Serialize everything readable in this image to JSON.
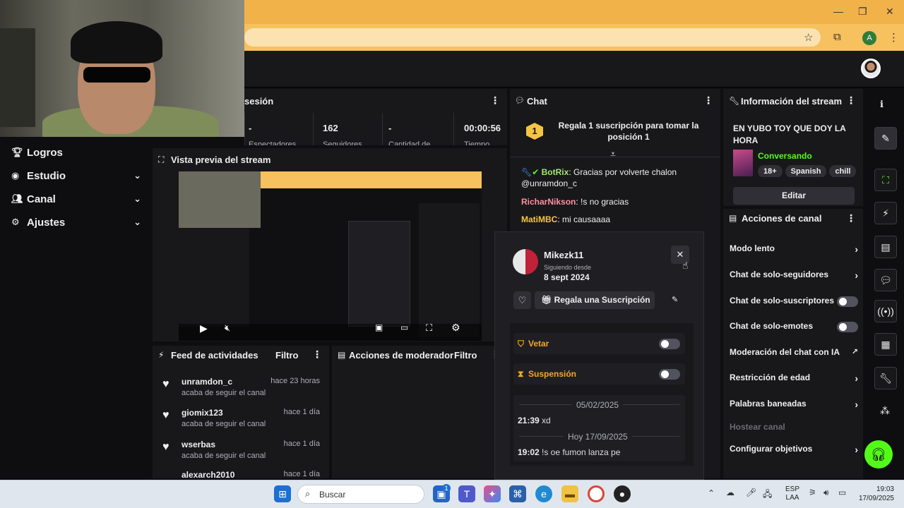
{
  "browser": {
    "window_controls": {
      "minimize": "—",
      "maximize": "❐",
      "close": "✕"
    },
    "profile_initial": "A"
  },
  "nav": {
    "items": [
      {
        "label": "Logros",
        "icon": "trophy-icon",
        "has_chevron": false
      },
      {
        "label": "Estudio",
        "icon": "studio-icon",
        "has_chevron": true
      },
      {
        "label": "Canal",
        "icon": "users-icon",
        "has_chevron": true
      },
      {
        "label": "Ajustes",
        "icon": "gear-icon",
        "has_chevron": true
      }
    ]
  },
  "session": {
    "title": "sesión",
    "stats": [
      {
        "value": "-",
        "label": "Espectadores"
      },
      {
        "value": "162",
        "label": "Seguidores"
      },
      {
        "value": "-",
        "label": "Cantidad de"
      },
      {
        "value": "00:00:56",
        "label": "Tiempo"
      }
    ]
  },
  "preview": {
    "title": "Vista previa del stream"
  },
  "feed": {
    "title": "Feed de actividades",
    "filter_label": "Filtro",
    "items": [
      {
        "name": "unramdon_c",
        "action": "acaba de seguir el canal",
        "time": "hace 23 horas"
      },
      {
        "name": "giomix123",
        "action": "acaba de seguir el canal",
        "time": "hace 1 día"
      },
      {
        "name": "wserbas",
        "action": "acaba de seguir el canal",
        "time": "hace 1 día"
      },
      {
        "name": "alexarch2010",
        "action": "acaba de seguir el canal",
        "time": "hace 1 día"
      }
    ]
  },
  "mod_actions": {
    "title": "Acciones de moderador",
    "filter_label": "Filtro"
  },
  "chat": {
    "title": "Chat",
    "pinned": {
      "badge": "1",
      "text": "Regala 1 suscripción para tomar la posición 1"
    },
    "messages": [
      {
        "user": "BotRix",
        "user_color": "#9fe870",
        "text": "Gracias por volverte chalon @unramdon_c"
      },
      {
        "user": "RicharNikson",
        "user_color": "#ff8fa3",
        "text": "!s no gracias"
      },
      {
        "user": "MatiMBC",
        "user_color": "#f5c542",
        "text": "mi causaaaa"
      }
    ]
  },
  "stream_info": {
    "title": "Información del stream",
    "stream_title": "EN YUBO TOY QUE DOY LA HORA",
    "category": "Conversando",
    "category_color": "#53fc18",
    "tags": [
      "18+",
      "Spanish",
      "chill"
    ],
    "edit_label": "Editar"
  },
  "channel_actions": {
    "title": "Acciones de canal",
    "rows": [
      {
        "label": "Modo lento",
        "control": "arrow"
      },
      {
        "label": "Chat de solo-seguidores",
        "control": "arrow"
      },
      {
        "label": "Chat de solo-suscriptores",
        "control": "toggle",
        "on": false
      },
      {
        "label": "Chat de solo-emotes",
        "control": "toggle",
        "on": false
      },
      {
        "label": "Moderación del chat con IA",
        "control": "external"
      },
      {
        "label": "Restricción de edad",
        "control": "arrow"
      },
      {
        "label": "Palabras baneadas",
        "control": "arrow"
      },
      {
        "label": "Hostear canal",
        "control": "none",
        "disabled": true
      },
      {
        "label": "Configurar objetivos",
        "control": "arrow"
      }
    ]
  },
  "user_popup": {
    "username": "Mikezk11",
    "following_label": "Siguiendo desde",
    "following_date": "8 sept 2024",
    "gift_label": "Regala una Suscripción",
    "ban_label": "Vetar",
    "timeout_label": "Suspensión",
    "history": [
      {
        "date": "05/02/2025",
        "time": "21:39",
        "text": "xd"
      },
      {
        "date": "Hoy 17/09/2025",
        "time": "19:02",
        "text": "!s oe fumon lanza pe"
      }
    ]
  },
  "taskbar": {
    "search_placeholder": "Buscar",
    "lang_top": "ESP",
    "lang_bottom": "LAA",
    "time": "19:03",
    "date": "17/09/2025",
    "store_badge": "1"
  },
  "colors": {
    "accent_green": "#53fc18",
    "warning": "#f5a623",
    "bg": "#0e0e10",
    "panel": "#18181b"
  }
}
